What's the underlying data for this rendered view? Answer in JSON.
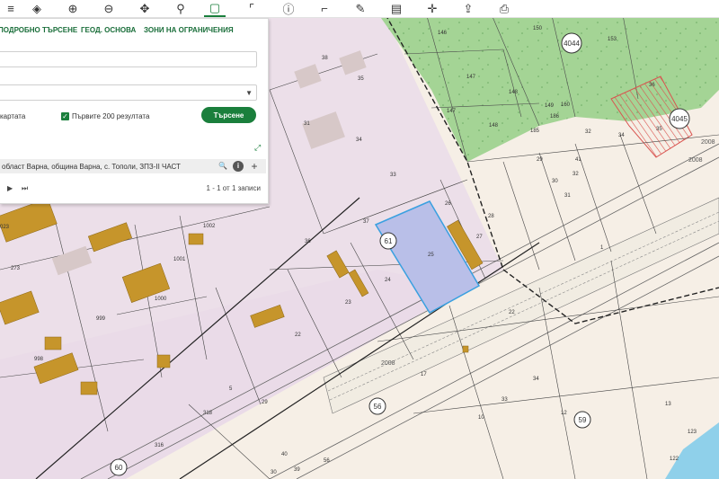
{
  "toolbar": {
    "icons": [
      "list-icon",
      "layers-icon",
      "zoom-in-icon",
      "zoom-out-icon",
      "pan-icon",
      "marker-icon",
      "select-rectangle-icon",
      "select-area-icon",
      "info-icon",
      "measure-icon",
      "draw-icon",
      "map-book-icon",
      "crosshair-icon",
      "export-icon",
      "print-icon"
    ],
    "active": "select-rectangle-icon"
  },
  "panel": {
    "tabs": [
      "ПОДРОБНО ТЪРСЕНЕ",
      "ГЕОД. ОСНОВА",
      "ЗОНИ НА ОГРАНИЧЕНИЯ"
    ],
    "input1_value": "",
    "select_value": "",
    "checkbox1_label": "картата",
    "checkbox2_label": "Първите 200 резултата",
    "search_label": "Търсене",
    "result_text": "област Варна, община Варна, с. Тополи, ЗПЗ-II ЧАСТ",
    "pager_text": "1 - 1 от 1 записи"
  },
  "map": {
    "colors": {
      "background": "#f6efe6",
      "urban": "#ecdfe9",
      "forest": "#a4d495",
      "building": "#c6952b",
      "selected": "#b9bfe8",
      "selected_border": "#3aa0e0",
      "hatch": "#d9534f"
    },
    "parcel_labels": [
      {
        "t": "146"
      },
      {
        "t": "150"
      },
      {
        "t": "153"
      },
      {
        "t": "147"
      },
      {
        "t": "148"
      },
      {
        "t": "147"
      },
      {
        "t": "148"
      },
      {
        "t": "149"
      },
      {
        "t": "38"
      },
      {
        "t": "35"
      },
      {
        "t": "31"
      },
      {
        "t": "34"
      },
      {
        "t": "33"
      },
      {
        "t": "37"
      },
      {
        "t": "36"
      },
      {
        "t": "26"
      },
      {
        "t": "28"
      },
      {
        "t": "27"
      },
      {
        "t": "25"
      },
      {
        "t": "24"
      },
      {
        "t": "23"
      },
      {
        "t": "22"
      },
      {
        "t": "22"
      },
      {
        "t": "1002"
      },
      {
        "t": "1001"
      },
      {
        "t": "1000"
      },
      {
        "t": "999"
      },
      {
        "t": "998"
      },
      {
        "t": "273"
      },
      {
        "t": "023"
      },
      {
        "t": "318"
      },
      {
        "t": "316"
      },
      {
        "t": "29"
      },
      {
        "t": "5"
      },
      {
        "t": "30"
      },
      {
        "t": "40"
      },
      {
        "t": "39"
      },
      {
        "t": "56"
      },
      {
        "t": "32"
      },
      {
        "t": "34"
      },
      {
        "t": "41"
      },
      {
        "t": "29"
      },
      {
        "t": "32"
      },
      {
        "t": "30"
      },
      {
        "t": "31"
      },
      {
        "t": "1"
      },
      {
        "t": "17"
      },
      {
        "t": "33"
      },
      {
        "t": "34"
      },
      {
        "t": "10"
      },
      {
        "t": "12"
      },
      {
        "t": "13"
      },
      {
        "t": "123"
      },
      {
        "t": "122"
      },
      {
        "t": "185"
      },
      {
        "t": "186"
      },
      {
        "t": "160"
      },
      {
        "t": "36"
      },
      {
        "t": "35"
      }
    ],
    "circle_labels": [
      "4044",
      "4045",
      "61",
      "56",
      "59",
      "60"
    ],
    "road_labels": [
      "2008",
      "2008",
      "2008"
    ]
  }
}
